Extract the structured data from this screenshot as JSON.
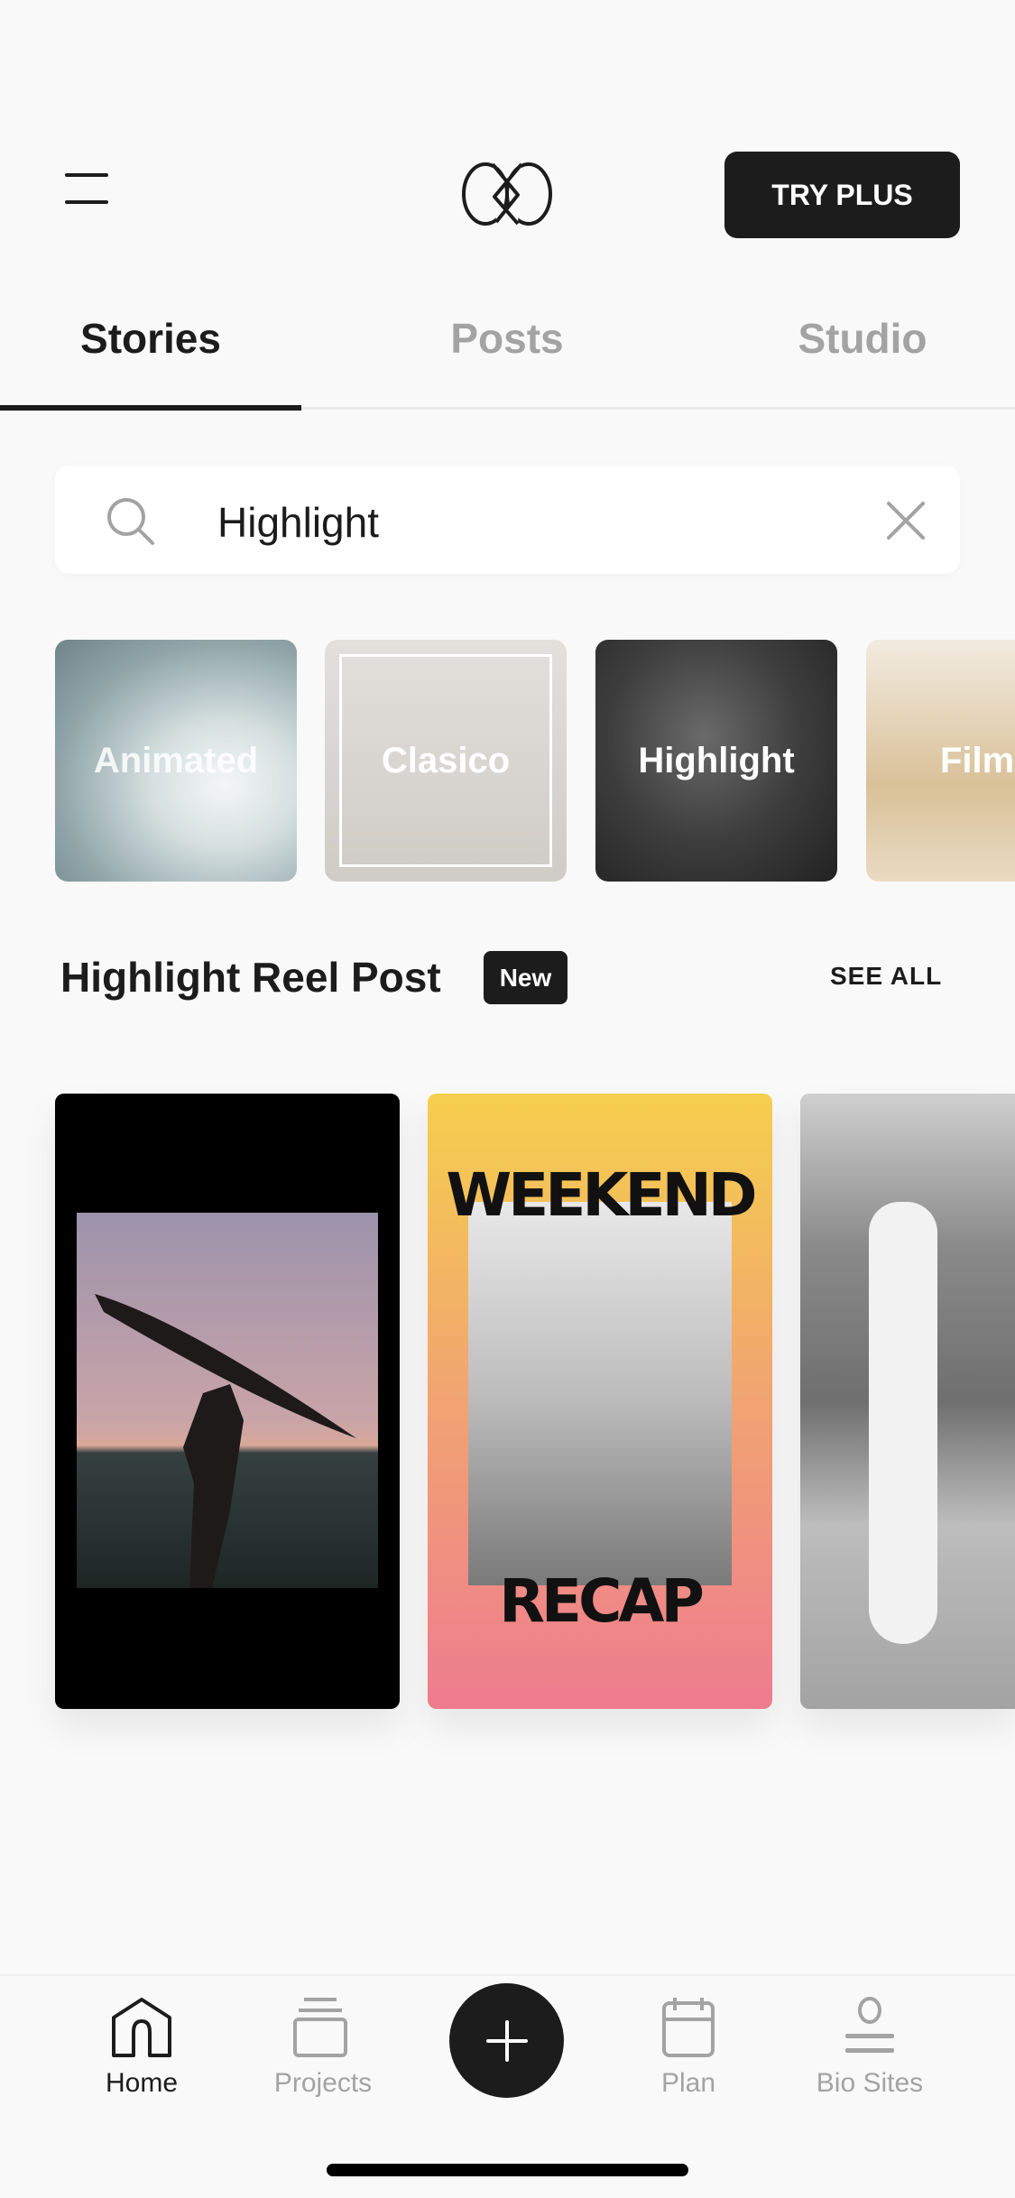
{
  "header": {
    "menu_icon": "hamburger-icon",
    "logo": "unfold-logo",
    "try_plus_label": "TRY PLUS"
  },
  "tabs": [
    {
      "label": "Stories",
      "active": true
    },
    {
      "label": "Posts",
      "active": false
    },
    {
      "label": "Studio",
      "active": false
    }
  ],
  "search": {
    "value": "Highlight",
    "search_icon": "search-icon",
    "clear_icon": "close-icon"
  },
  "templates": [
    {
      "label": "Animated"
    },
    {
      "label": "Clasico"
    },
    {
      "label": "Highlight"
    },
    {
      "label": "Film"
    }
  ],
  "section": {
    "title": "Highlight Reel Post",
    "badge": "New",
    "see_all": "SEE ALL"
  },
  "cards": [
    {
      "poster_top": "",
      "poster_bottom": ""
    },
    {
      "poster_top": "WEEKEND",
      "poster_bottom": "RECAP"
    },
    {
      "poster_top": "",
      "poster_bottom": ""
    }
  ],
  "bottom_nav": [
    {
      "label": "Home",
      "icon": "home-icon",
      "active": true
    },
    {
      "label": "Projects",
      "icon": "projects-icon",
      "active": false
    },
    {
      "label": "",
      "icon": "plus-icon",
      "active": false
    },
    {
      "label": "Plan",
      "icon": "calendar-icon",
      "active": false
    },
    {
      "label": "Bio Sites",
      "icon": "person-icon",
      "active": false
    }
  ],
  "colors": {
    "accent": "#1c1c1c",
    "inactive": "#a3a3a3",
    "background": "#f9f9f9"
  }
}
